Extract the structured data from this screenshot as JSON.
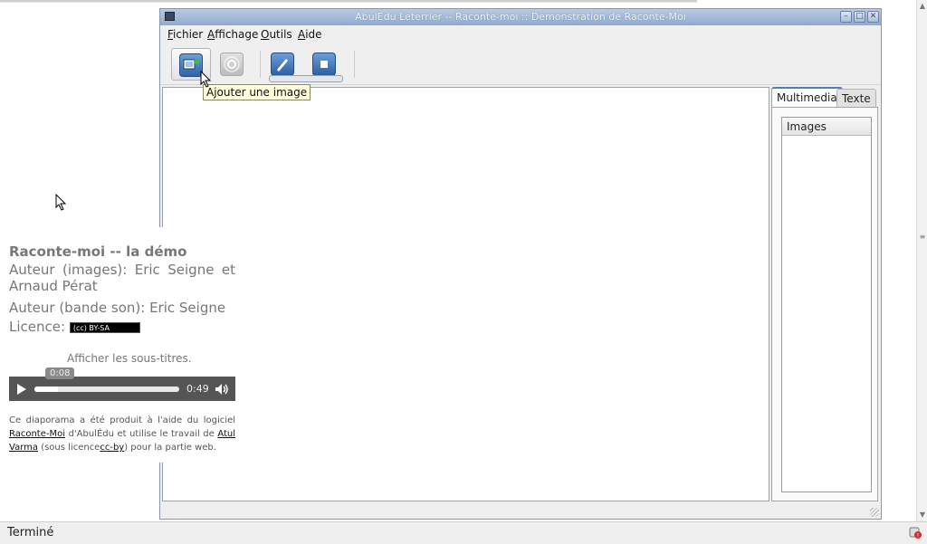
{
  "window": {
    "title": "AbulÉdu Leterrier -- Raconte-moi :: Demonstration de Raconte-Moi",
    "controls": [
      "minimize-icon",
      "maximize-icon",
      "close-icon"
    ]
  },
  "menu": [
    {
      "label": "Fichier"
    },
    {
      "label": "Affichage"
    },
    {
      "label": "Outils"
    },
    {
      "label": "Aide"
    }
  ],
  "toolbar": {
    "buttons": [
      "add-image-icon",
      "sound-icon",
      "edit-pen-icon",
      "stop-icon"
    ],
    "tooltip": "Ajouter une image"
  },
  "tabs": [
    {
      "label": "Multimedia",
      "selected": true
    },
    {
      "label": "Texte",
      "selected": false
    }
  ],
  "images_list": {
    "header": "Images"
  },
  "info": {
    "title": "Raconte-moi -- la démo",
    "author_images": "Auteur (images): Eric Seigne et Arnaud Pérat",
    "author_sound": "Auteur (bande son): Eric Seigne",
    "licence_label": "Licence:",
    "licence_badge": "(cc) BY-SA",
    "subtitles": "Afficher les sous-titres."
  },
  "player": {
    "current_time": "0:08",
    "duration": "0:49",
    "progress": 0.16
  },
  "credits": {
    "p1": "Ce diaporama a été produit à l'aide du logiciel",
    "link1": "Raconte-Moi",
    "p2": "d'AbulÉdu et utilise le travail de",
    "link2": "Atul Varma",
    "p3": "(sous licence",
    "link3": "cc-by",
    "p4": ") pour la partie web."
  },
  "status": {
    "text": "Terminé"
  },
  "colors": {
    "accent": "#4a7fc1",
    "player_bg": "#555555"
  }
}
